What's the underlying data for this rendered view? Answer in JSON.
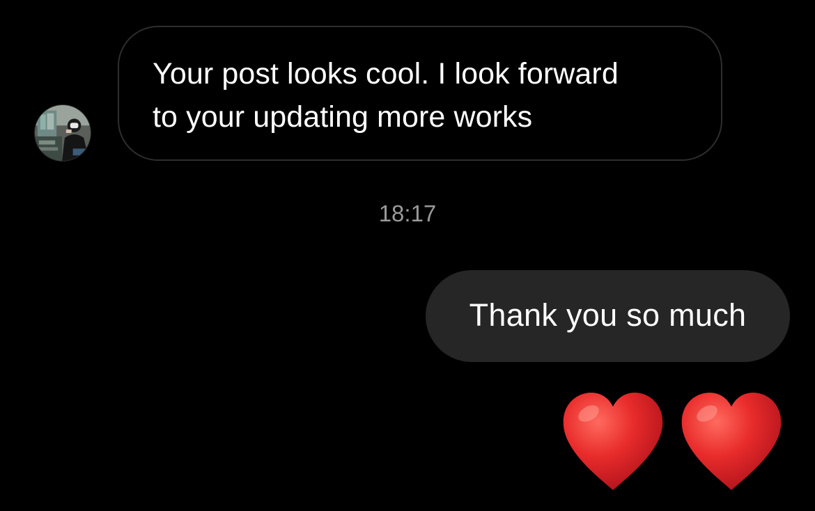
{
  "conversation": {
    "received_message": {
      "text": "Your post looks cool. I look forward to your updating more works",
      "line1": "Your post looks cool. I look forward",
      "line2": "to your updating more works"
    },
    "timestamp": "18:17",
    "sent_message": {
      "text": "Thank you so much"
    },
    "sent_emoji": {
      "icons": [
        "red-heart-icon",
        "red-heart-icon"
      ]
    }
  },
  "colors": {
    "background": "#000000",
    "received_bubble_border": "#2e2e2e",
    "sent_bubble_fill": "#262626",
    "timestamp": "#9a9a9a",
    "heart": "#e0262a"
  }
}
